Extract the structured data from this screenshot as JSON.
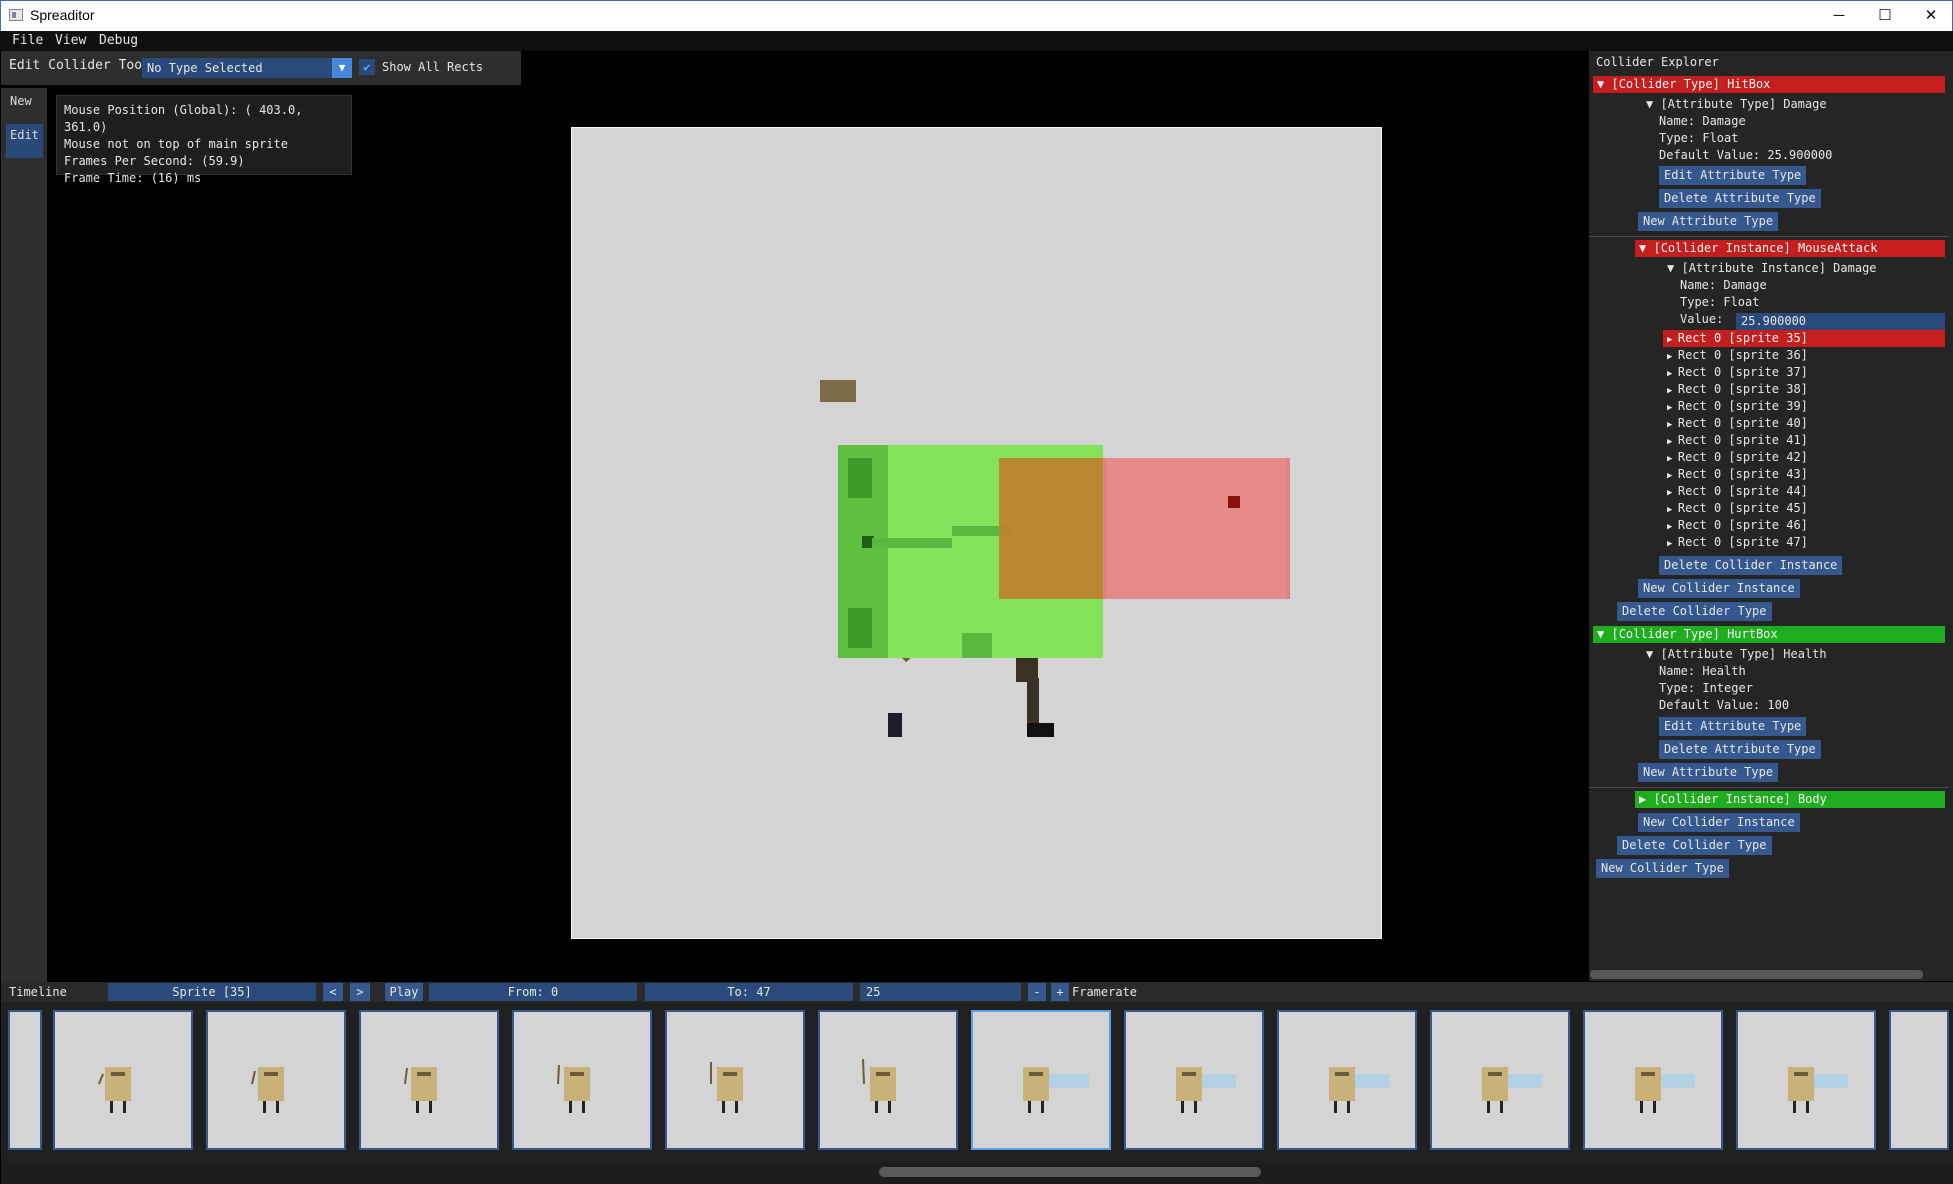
{
  "window": {
    "title": "Spreaditor",
    "minimize": "─",
    "maximize": "☐",
    "close": "✕"
  },
  "menu": [
    "File",
    "View",
    "Debug"
  ],
  "tabs": {
    "new": "New",
    "edit": "Edit"
  },
  "toolbar": {
    "label": "Edit Collider Tool",
    "type_value": "No Type Selected",
    "show_all_rects": "Show All Rects",
    "show_all_checked": true
  },
  "info": {
    "mouse_pos": "Mouse Position (Global): ( 403.0, 361.0)",
    "mouse_state": "Mouse not on top of main sprite",
    "fps": "Frames Per Second: (59.9)",
    "frame_time": "Frame Time: (16) ms"
  },
  "explorer": {
    "title": "Collider Explorer",
    "hitbox": {
      "header": "[Collider Type] HitBox",
      "attr_header": "[Attribute Type] Damage",
      "name": "Name: Damage",
      "type": "Type: Float",
      "default": "Default Value: 25.900000",
      "edit_attr": "Edit Attribute Type",
      "delete_attr": "Delete Attribute Type",
      "new_attr": "New Attribute Type",
      "instance_header": "[Collider Instance] MouseAttack",
      "attr_instance": "[Attribute Instance] Damage",
      "inst_name": "Name: Damage",
      "inst_type": "Type: Float",
      "value_label": "Value:",
      "value": "25.900000",
      "rects": [
        "Rect 0 [sprite 35]",
        "Rect 0 [sprite 36]",
        "Rect 0 [sprite 37]",
        "Rect 0 [sprite 38]",
        "Rect 0 [sprite 39]",
        "Rect 0 [sprite 40]",
        "Rect 0 [sprite 41]",
        "Rect 0 [sprite 42]",
        "Rect 0 [sprite 43]",
        "Rect 0 [sprite 44]",
        "Rect 0 [sprite 45]",
        "Rect 0 [sprite 46]",
        "Rect 0 [sprite 47]"
      ],
      "delete_instance": "Delete Collider Instance",
      "new_instance": "New Collider Instance",
      "delete_type": "Delete Collider Type"
    },
    "hurtbox": {
      "header": "[Collider Type] HurtBox",
      "attr_header": "[Attribute Type] Health",
      "name": "Name: Health",
      "type": "Type: Integer",
      "default": "Default Value: 100",
      "edit_attr": "Edit Attribute Type",
      "delete_attr": "Delete Attribute Type",
      "new_attr": "New Attribute Type",
      "instance_header": "[Collider Instance] Body",
      "new_instance": "New Collider Instance",
      "delete_type": "Delete Collider Type"
    },
    "new_type": "New Collider Type"
  },
  "timeline": {
    "label": "Timeline",
    "sprite": "Sprite [35]",
    "prev": "<",
    "next": ">",
    "play": "Play",
    "from": "From: 0",
    "to": "To: 47",
    "framerate_value": "25",
    "minus": "-",
    "plus": "+",
    "framerate_label": "Framerate"
  },
  "colors": {
    "hitbox": "#c41e1e",
    "hurtbox": "#1fae1f",
    "button": "#35598f",
    "field": "#294a7a"
  }
}
